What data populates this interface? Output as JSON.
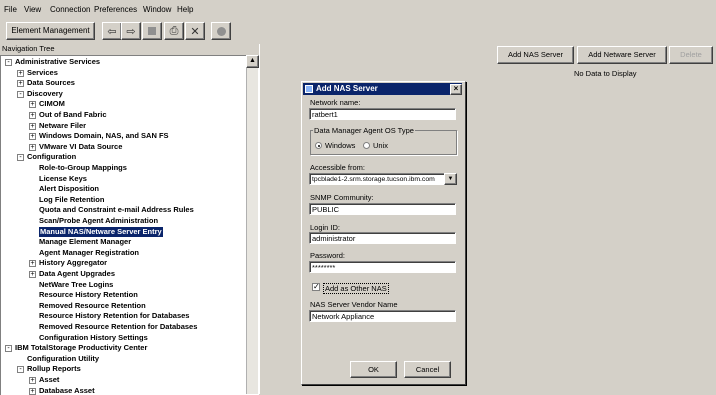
{
  "menu": [
    "File",
    "View",
    "Connection",
    "Preferences",
    "Window",
    "Help"
  ],
  "toolbar": {
    "element_management": "Element Management",
    "icons": [
      "arrow-left-icon",
      "arrow-right-icon",
      "stop-icon",
      "print-icon",
      "delete-icon",
      "circle-icon"
    ]
  },
  "navigation": {
    "header": "Navigation Tree",
    "items": [
      {
        "label": "Administrative Services",
        "level": 0,
        "expander": "-"
      },
      {
        "label": "Services",
        "level": 1,
        "expander": "+"
      },
      {
        "label": "Data Sources",
        "level": 1,
        "expander": "+"
      },
      {
        "label": "Discovery",
        "level": 1,
        "expander": "-"
      },
      {
        "label": "CIMOM",
        "level": 2,
        "expander": "+"
      },
      {
        "label": "Out of Band Fabric",
        "level": 2,
        "expander": "+"
      },
      {
        "label": "Netware Filer",
        "level": 2,
        "expander": "+"
      },
      {
        "label": "Windows Domain, NAS, and SAN FS",
        "level": 2,
        "expander": "+"
      },
      {
        "label": "VMware VI Data Source",
        "level": 2,
        "expander": "+"
      },
      {
        "label": "Configuration",
        "level": 1,
        "expander": "-"
      },
      {
        "label": "Role-to-Group Mappings",
        "level": 2,
        "expander": ""
      },
      {
        "label": "License Keys",
        "level": 2,
        "expander": ""
      },
      {
        "label": "Alert Disposition",
        "level": 2,
        "expander": ""
      },
      {
        "label": "Log File Retention",
        "level": 2,
        "expander": ""
      },
      {
        "label": "Quota and Constraint e-mail Address Rules",
        "level": 2,
        "expander": ""
      },
      {
        "label": "Scan/Probe Agent Administration",
        "level": 2,
        "expander": ""
      },
      {
        "label": "Manual NAS/Netware Server Entry",
        "level": 2,
        "expander": "",
        "selected": true
      },
      {
        "label": "Manage Element Manager",
        "level": 2,
        "expander": ""
      },
      {
        "label": "Agent Manager Registration",
        "level": 2,
        "expander": ""
      },
      {
        "label": "History Aggregator",
        "level": 2,
        "expander": "+"
      },
      {
        "label": "Data Agent Upgrades",
        "level": 2,
        "expander": "+"
      },
      {
        "label": "NetWare Tree Logins",
        "level": 2,
        "expander": ""
      },
      {
        "label": "Resource History Retention",
        "level": 2,
        "expander": ""
      },
      {
        "label": "Removed Resource Retention",
        "level": 2,
        "expander": ""
      },
      {
        "label": "Resource History Retention for Databases",
        "level": 2,
        "expander": ""
      },
      {
        "label": "Removed Resource Retention for Databases",
        "level": 2,
        "expander": ""
      },
      {
        "label": "Configuration History Settings",
        "level": 2,
        "expander": ""
      },
      {
        "label": "IBM TotalStorage Productivity Center",
        "level": 0,
        "expander": "-"
      },
      {
        "label": "Configuration Utility",
        "level": 1,
        "expander": ""
      },
      {
        "label": "Rollup Reports",
        "level": 1,
        "expander": "-"
      },
      {
        "label": "Asset",
        "level": 2,
        "expander": "+"
      },
      {
        "label": "Database Asset",
        "level": 2,
        "expander": "+"
      }
    ]
  },
  "right": {
    "buttons": [
      "Add NAS Server",
      "Add Netware Server",
      "Delete"
    ],
    "empty_text": "No Data to Display"
  },
  "dialog": {
    "title": "Add NAS Server",
    "network_name_label": "Network name:",
    "network_name_value": "ratbert1",
    "os_group_label": "Data Manager Agent OS Type",
    "os_windows": "Windows",
    "os_unix": "Unix",
    "accessible_label": "Accessible from:",
    "accessible_value": "tpcblade1-2.srm.storage.tucson.ibm.com",
    "snmp_label": "SNMP Community:",
    "snmp_value": "PUBLIC",
    "login_label": "Login ID:",
    "login_value": "administrator",
    "password_label": "Password:",
    "password_value": "********",
    "add_other_label": "Add as Other NAS",
    "vendor_label": "NAS Server Vendor Name",
    "vendor_value": "Network Appliance",
    "ok": "OK",
    "cancel": "Cancel",
    "close": "×"
  }
}
